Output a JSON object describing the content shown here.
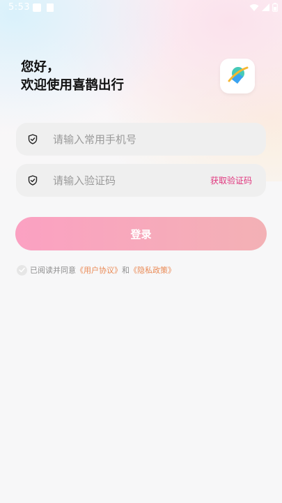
{
  "status_bar": {
    "time": "5:53",
    "app_icon": "app-icon",
    "notification_icon": "notification-icon",
    "wifi_icon": "wifi-icon",
    "signal_icon": "signal-icon",
    "battery_icon": "battery-icon"
  },
  "header": {
    "greeting_line1": "您好，",
    "greeting_line2": "欢迎使用喜鹊出行",
    "logo_icon": "app-logo-icon"
  },
  "form": {
    "phone": {
      "placeholder": "请输入常用手机号",
      "value": "",
      "icon": "shield-check-icon"
    },
    "code": {
      "placeholder": "请输入验证码",
      "value": "",
      "icon": "shield-check-icon"
    },
    "get_code_label": "获取验证码",
    "login_label": "登录"
  },
  "agreement": {
    "prefix": "已阅读并同意",
    "user_agreement": "《用户协议》",
    "and": "和",
    "privacy_policy": "《隐私政策》"
  },
  "colors": {
    "accent_pink": "#e0357d",
    "link_orange": "#ea8a55",
    "button_gradient_start": "#fba1c2",
    "button_gradient_end": "#f3b1b5"
  }
}
